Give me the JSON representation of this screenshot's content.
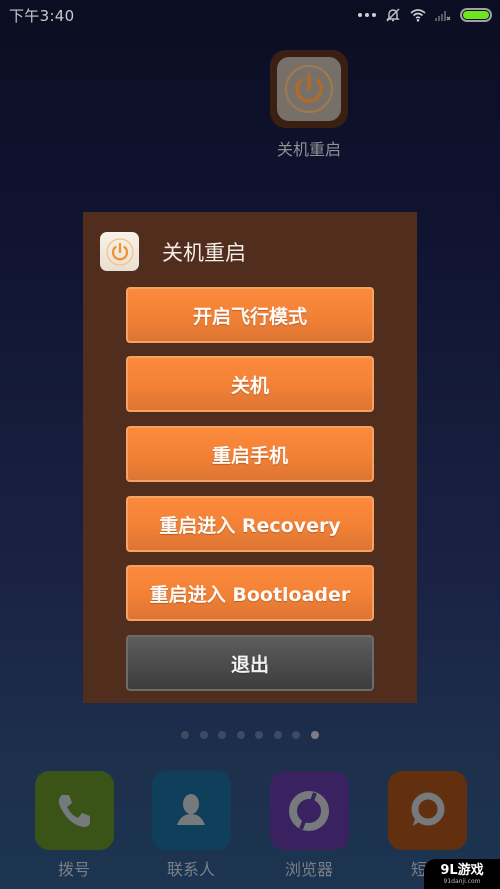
{
  "statusbar": {
    "time": "下午3:40",
    "icons": [
      "more-dots-icon",
      "alarm-off-icon",
      "wifi-icon",
      "signal-no-sim-icon",
      "battery-icon"
    ],
    "battery_percent": 100,
    "battery_color": "#6ee51c"
  },
  "desktop_app": {
    "label": "关机重启",
    "icon": "power-icon"
  },
  "dialog": {
    "title": "关机重启",
    "icon": "power-icon",
    "buttons": [
      {
        "label": "开启飞行模式",
        "style": "orange"
      },
      {
        "label": "关机",
        "style": "orange"
      },
      {
        "label": "重启手机",
        "style": "orange"
      },
      {
        "label": "重启进入 Recovery",
        "style": "orange"
      },
      {
        "label": "重启进入 Bootloader",
        "style": "orange"
      },
      {
        "label": "退出",
        "style": "gray"
      }
    ],
    "accent_color": "#f38236",
    "background_color": "#512d1e"
  },
  "page_indicator": {
    "total": 8,
    "active_index": 7
  },
  "dock": {
    "apps": [
      {
        "label": "拨号",
        "icon": "phone-icon",
        "color": "#3a5417"
      },
      {
        "label": "联系人",
        "icon": "contact-icon",
        "color": "#103f5c"
      },
      {
        "label": "浏览器",
        "icon": "browser-icon",
        "color": "#3a2260"
      },
      {
        "label": "短信",
        "icon": "message-icon",
        "color": "#62300e"
      }
    ]
  },
  "watermark": {
    "main": "9L游戏",
    "sub": "91danji.com"
  }
}
